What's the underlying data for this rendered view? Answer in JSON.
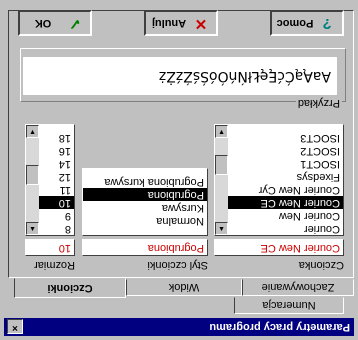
{
  "window": {
    "title": "Parametry pracy programu",
    "close_label": "×"
  },
  "tabs": [
    "Numeracja",
    "Zachowywanie",
    "Widok",
    "Czcionki"
  ],
  "font": {
    "label": "Czcionka",
    "value": "Courier New CE",
    "items": [
      "Courier",
      "Courier New",
      "Courier New CE",
      "Courier New Cyr",
      "Fixedsys",
      "ISOCT1",
      "ISOCT2",
      "ISOCT3"
    ],
    "selected": "Courier New CE"
  },
  "style": {
    "label": "Styl czcionki",
    "value": "Pogrubiona",
    "items": [
      "Normalna",
      "Kursywa",
      "Pogrubiona",
      "Pogrubiona kursywa"
    ],
    "selected": "Pogrubiona"
  },
  "size": {
    "label": "Rozmiar",
    "value": "10",
    "items": [
      "8",
      "9",
      "10",
      "11",
      "12",
      "14",
      "16",
      "18"
    ],
    "selected": "10"
  },
  "preview": {
    "label": "Przykład",
    "text": "AaĄąĆćĘęŁłŃńÓóŚśŹźŻż"
  },
  "buttons": {
    "ok": {
      "label": "OK",
      "icon": "check-icon",
      "color": "#008000"
    },
    "cancel": {
      "label": "Anuluj",
      "icon": "x-icon",
      "color": "#cc0000"
    },
    "help": {
      "label": "Pomoc",
      "icon": "question-icon",
      "color": "#008080"
    }
  },
  "colors": {
    "titlebar": "#000080",
    "face": "#c0c0c0",
    "selection": "#000000",
    "value_text": "#cc0000"
  }
}
